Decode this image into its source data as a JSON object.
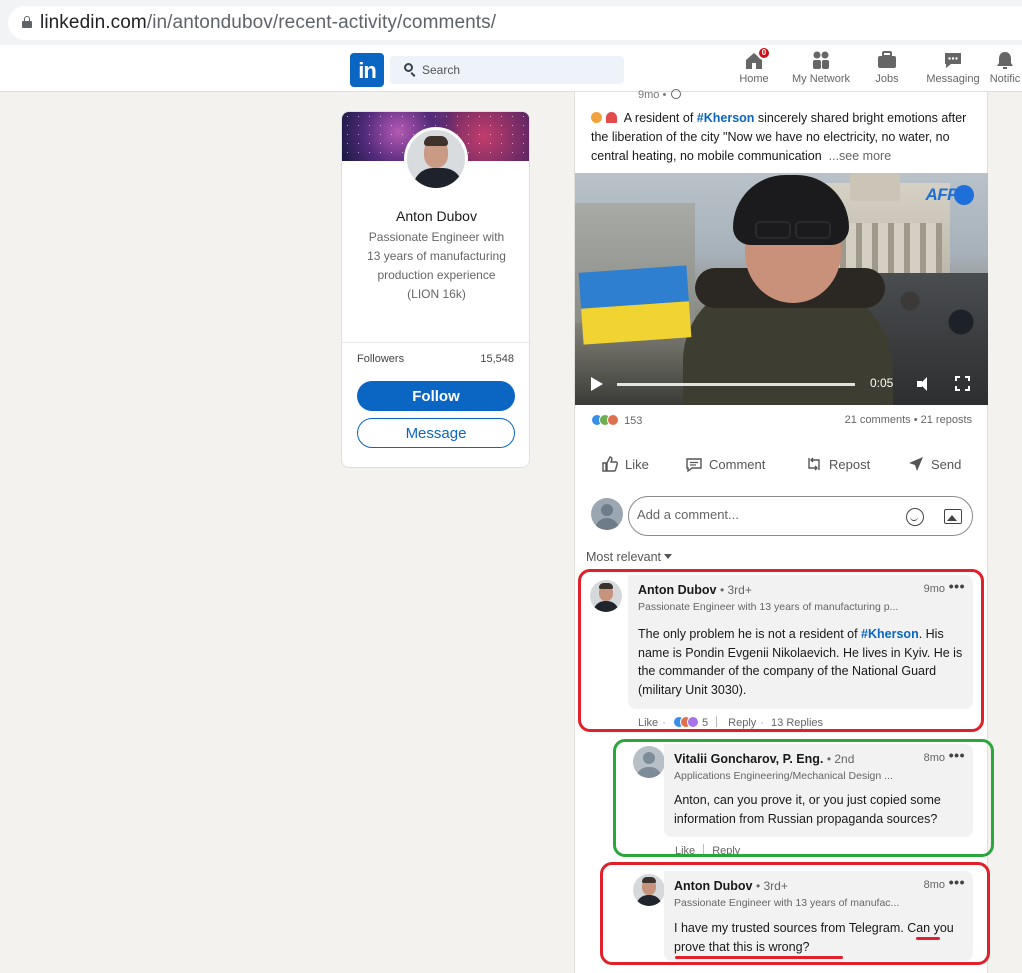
{
  "browser": {
    "url_host": "linkedin.com",
    "url_path": "/in/antondubov/recent-activity/comments/"
  },
  "nav": {
    "logo": "in",
    "search_placeholder": "Search",
    "items": [
      {
        "label": "Home",
        "badge": "0"
      },
      {
        "label": "My Network"
      },
      {
        "label": "Jobs"
      },
      {
        "label": "Messaging"
      },
      {
        "label": "Notific"
      }
    ]
  },
  "profile": {
    "name": "Anton Dubov",
    "headline": "Passionate Engineer with 13 years of manufacturing production experience (LION 16k)",
    "followers_label": "Followers",
    "followers_count": "15,548",
    "follow_label": "Follow",
    "message_label": "Message"
  },
  "post": {
    "time": "9mo •",
    "text_before": "A resident of ",
    "hashtag": "#Kherson",
    "text_after": " sincerely shared bright emotions after the liberation of the city \"Now we have no electricity, no water, no central heating, no mobile communication",
    "see_more": "...see more",
    "video": {
      "watermark": "AFP",
      "time": "0:05"
    },
    "reactions_count": "153",
    "comments_reposts": "21 comments • 21 reposts",
    "actions": {
      "like": "Like",
      "comment": "Comment",
      "repost": "Repost",
      "send": "Send"
    },
    "comment_placeholder": "Add a comment...",
    "sort_label": "Most relevant"
  },
  "comments": [
    {
      "name": "Anton Dubov",
      "degree": "• 3rd+",
      "headline": "Passionate Engineer with 13 years of manufacturing p...",
      "time": "9mo",
      "body_before": "The only problem he is not a resident of ",
      "hashtag": "#Kherson",
      "body_after": ". His name is Pondin Evgenii Nikolaevich. He lives in Kyiv. He is the commander of the company of the National Guard (military Unit 3030).",
      "like": "Like",
      "reactions": "5",
      "reply": "Reply",
      "replies": "13 Replies"
    },
    {
      "name": "Vitalii Goncharov, P. Eng.",
      "degree": "• 2nd",
      "headline": "Applications Engineering/Mechanical Design ...",
      "time": "8mo",
      "body": "Anton, can you prove it, or you just copied some information from Russian propaganda sources?",
      "like": "Like",
      "reply": "Reply"
    },
    {
      "name": "Anton Dubov",
      "degree": "• 3rd+",
      "headline": "Passionate Engineer with 13 years of manufac...",
      "time": "8mo",
      "body_before": "I have my trusted sources from Telegram. ",
      "body_highlight": "Can you prove that this is wrong?"
    }
  ],
  "colors": {
    "brand": "#0a66c2",
    "annotation_red": "#e0202a",
    "annotation_green": "#2aa63c"
  }
}
